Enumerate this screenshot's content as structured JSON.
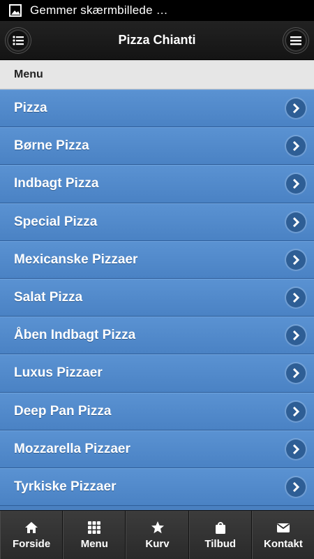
{
  "status_bar": {
    "text": "Gemmer skærmbillede …",
    "icon": "image-icon"
  },
  "header": {
    "title": "Pizza Chianti",
    "left_icon": "list-icon",
    "right_icon": "menu-icon"
  },
  "section": {
    "title": "Menu"
  },
  "menu": {
    "items": [
      {
        "label": "Pizza"
      },
      {
        "label": "Børne Pizza"
      },
      {
        "label": "Indbagt Pizza"
      },
      {
        "label": "Special Pizza"
      },
      {
        "label": "Mexicanske Pizzaer"
      },
      {
        "label": "Salat Pizza"
      },
      {
        "label": "Åben Indbagt Pizza"
      },
      {
        "label": "Luxus Pizzaer"
      },
      {
        "label": "Deep Pan Pizza"
      },
      {
        "label": "Mozzarella Pizzaer"
      },
      {
        "label": "Tyrkiske Pizzaer"
      }
    ]
  },
  "tabbar": {
    "tabs": [
      {
        "label": "Forside",
        "icon": "home-icon"
      },
      {
        "label": "Menu",
        "icon": "grid-icon"
      },
      {
        "label": "Kurv",
        "icon": "star-icon"
      },
      {
        "label": "Tilbud",
        "icon": "bag-icon"
      },
      {
        "label": "Kontakt",
        "icon": "mail-icon"
      }
    ]
  },
  "colors": {
    "accent": "#4a82c4",
    "header_bg": "#1a1a1a",
    "section_bg": "#e6e6e6",
    "tabbar_bg": "#2b2b2b"
  }
}
